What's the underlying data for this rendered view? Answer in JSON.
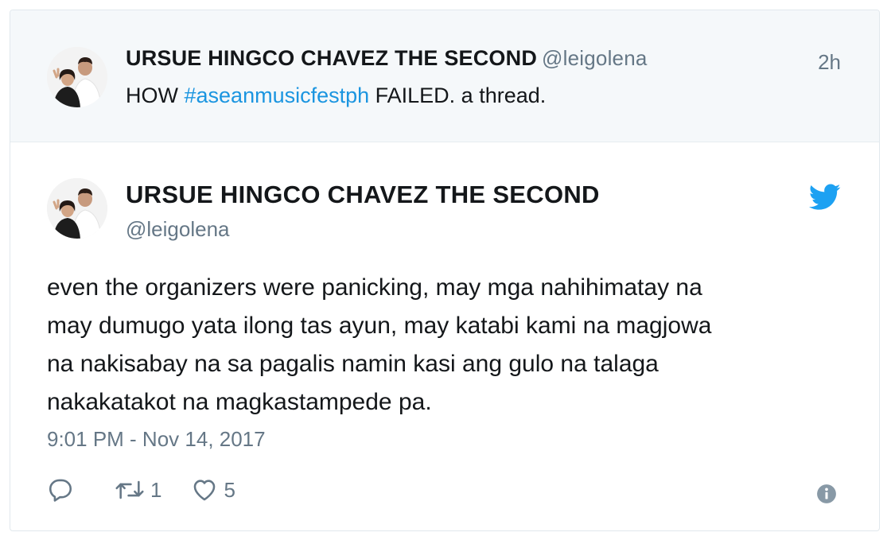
{
  "parent_tweet": {
    "display_name": "URSUE HINGCO CHAVEZ THE SECOND",
    "handle": "@leigolena",
    "time_ago": "2h",
    "text_before": "HOW ",
    "hashtag": "#aseanmusicfestph",
    "text_after": " FAILED. a thread.",
    "avatar_icon": "profile-photo-icon"
  },
  "main_tweet": {
    "display_name": "URSUE HINGCO CHAVEZ THE SECOND",
    "handle": "@leigolena",
    "body_lines": [
      "even the organizers were panicking, may mga nahihimatay na",
      "may dumugo yata ilong tas ayun, may katabi kami na magjowa",
      "na nakisabay na sa pagalis namin kasi ang gulo na talaga",
      "nakakatakot na magkastampede pa."
    ],
    "timestamp": "9:01 PM - Nov 14, 2017",
    "retweet_count": "1",
    "like_count": "5",
    "icons": {
      "reply": "reply-icon",
      "retweet": "retweet-icon",
      "like": "heart-icon",
      "info": "info-icon",
      "brand": "twitter-bird-icon"
    }
  },
  "colors": {
    "brand_blue": "#1da1f2",
    "hashtag_blue": "#1b95e0",
    "secondary_text": "#657786",
    "primary_text": "#14171a",
    "parent_background": "#f5f8fa",
    "border": "#e1e8ed"
  }
}
